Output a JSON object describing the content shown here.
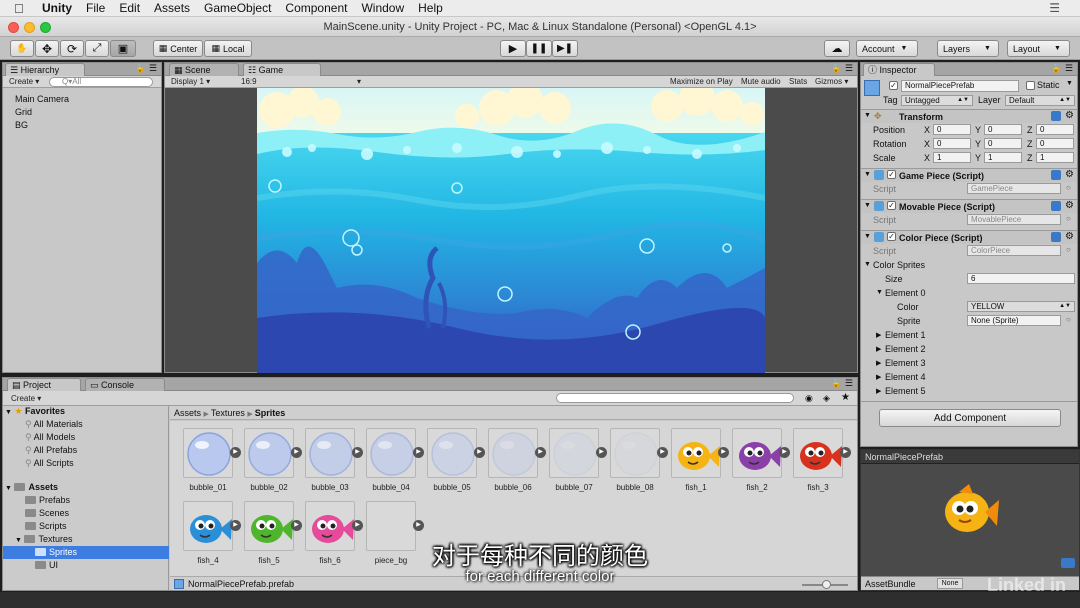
{
  "menubar": {
    "app": "Unity",
    "items": [
      "File",
      "Edit",
      "Assets",
      "GameObject",
      "Component",
      "Window",
      "Help"
    ]
  },
  "window": {
    "title": "MainScene.unity - Unity Project - PC, Mac & Linux Standalone (Personal) <OpenGL 4.1>"
  },
  "toolbar": {
    "pivot": "Center",
    "space": "Local",
    "account": "Account",
    "layers": "Layers",
    "layout": "Layout"
  },
  "hierarchy": {
    "tab": "Hierarchy",
    "create": "Create",
    "search_placeholder": "Q▾All",
    "items": [
      "Main Camera",
      "Grid",
      "BG"
    ]
  },
  "scene_tab": "Scene",
  "game": {
    "tab": "Game",
    "display": "Display 1",
    "aspect": "16:9",
    "maximize": "Maximize on Play",
    "mute": "Mute audio",
    "stats": "Stats",
    "gizmos": "Gizmos"
  },
  "inspector": {
    "tab": "Inspector",
    "object_name": "NormalPiecePrefab",
    "static_label": "Static",
    "tag_label": "Tag",
    "tag_value": "Untagged",
    "layer_label": "Layer",
    "layer_value": "Default",
    "transform": {
      "title": "Transform",
      "position": {
        "label": "Position",
        "x": "0",
        "y": "0",
        "z": "0"
      },
      "rotation": {
        "label": "Rotation",
        "x": "0",
        "y": "0",
        "z": "0"
      },
      "scale": {
        "label": "Scale",
        "x": "1",
        "y": "1",
        "z": "1"
      },
      "axis_x": "X",
      "axis_y": "Y",
      "axis_z": "Z"
    },
    "game_piece": {
      "title": "Game Piece (Script)",
      "script_label": "Script",
      "script_value": "GamePiece"
    },
    "movable_piece": {
      "title": "Movable Piece (Script)",
      "script_label": "Script",
      "script_value": "MovablePiece"
    },
    "color_piece": {
      "title": "Color Piece (Script)",
      "script_label": "Script",
      "script_value": "ColorPiece",
      "color_sprites": "Color Sprites",
      "size_label": "Size",
      "size_value": "6",
      "element0": "Element 0",
      "color_label": "Color",
      "color_value": "YELLOW",
      "sprite_label": "Sprite",
      "sprite_value": "None (Sprite)",
      "elements": [
        "Element 1",
        "Element 2",
        "Element 3",
        "Element 4",
        "Element 5"
      ]
    },
    "add_component": "Add Component"
  },
  "project": {
    "tab": "Project",
    "console_tab": "Console",
    "create": "Create",
    "favorites": "Favorites",
    "favorite_items": [
      "All Materials",
      "All Models",
      "All Prefabs",
      "All Scripts"
    ],
    "assets": "Assets",
    "folders": [
      "Prefabs",
      "Scenes",
      "Scripts",
      "Textures"
    ],
    "textures_children": [
      "Sprites",
      "UI"
    ],
    "breadcrumb": [
      "Assets",
      "Textures",
      "Sprites"
    ],
    "assets_grid": [
      "bubble_01",
      "bubble_02",
      "bubble_03",
      "bubble_04",
      "bubble_05",
      "bubble_06",
      "bubble_07",
      "bubble_08",
      "fish_1",
      "fish_2",
      "fish_3",
      "fish_4",
      "fish_5",
      "fish_6",
      "piece_bg"
    ],
    "selected_file": "NormalPiecePrefab.prefab"
  },
  "preview": {
    "title": "NormalPiecePrefab",
    "assetbundle_label": "AssetBundle",
    "assetbundle_value": "None"
  },
  "subtitles": {
    "cn": "对于每种不同的颜色",
    "en": "for each different color"
  },
  "watermark": "Linked in",
  "colors": {
    "fish_yellow": "#f5b414",
    "fish_purple": "#8b3fa8",
    "fish_red": "#d8321f",
    "fish_blue": "#2b8fd8",
    "fish_green": "#4fb52c",
    "fish_pink": "#e64a9a",
    "ocean_top": "#6fe3f5",
    "ocean_bottom": "#2f4fbf"
  }
}
